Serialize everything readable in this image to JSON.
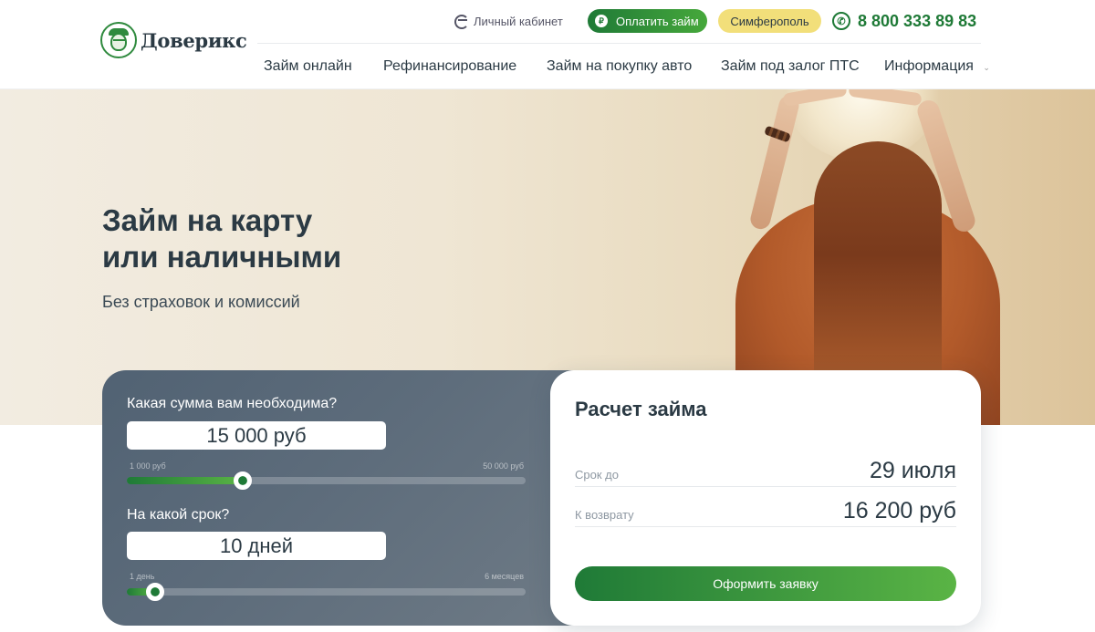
{
  "header": {
    "logo_text": "Доверикс",
    "cabinet_label": "Личный кабинет",
    "pay_label": "Оплатить займ",
    "pay_icon_glyph": "₽",
    "city_label": "Симферополь",
    "phone": "8 800 333 89 83"
  },
  "nav": {
    "items": [
      {
        "label": "Займ онлайн"
      },
      {
        "label": "Рефинансирование"
      },
      {
        "label": "Займ на покупку авто"
      },
      {
        "label": "Займ под залог ПТС"
      },
      {
        "label": "Информация"
      }
    ]
  },
  "hero": {
    "title_line1": "Займ на карту",
    "title_line2": "или наличными",
    "subtitle": "Без страховок и комиссий"
  },
  "calculator": {
    "amount_question": "Какая сумма вам необходима?",
    "amount_value": "15 000 руб",
    "amount_min_label": "1 000 руб",
    "amount_max_label": "50 000 руб",
    "amount_fraction": 0.29,
    "term_question": "На какой срок?",
    "term_value": "10 дней",
    "term_min_label": "1 день",
    "term_max_label": "6 месяцев",
    "term_fraction": 0.07
  },
  "result": {
    "title": "Расчет займа",
    "term_label": "Срок до",
    "term_value": "29 июля",
    "return_label": "К возврату",
    "return_value": "16 200 руб",
    "apply_label": "Оформить заявку"
  },
  "colors": {
    "brand_green": "#1f7a37",
    "accent_green": "#5ab445",
    "city_yellow": "#f2df7a",
    "text_dark": "#2b3a44"
  }
}
